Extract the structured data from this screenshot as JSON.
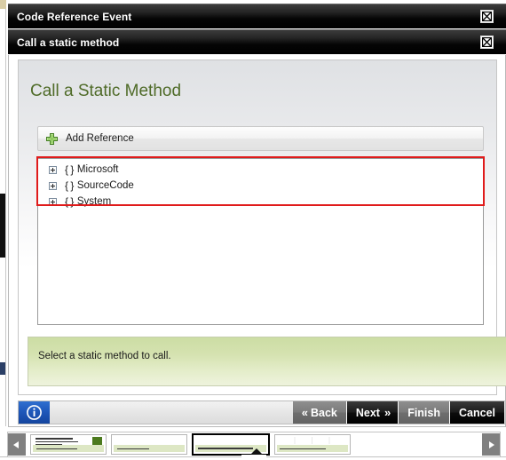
{
  "window": {
    "outer_title": "Code Reference Event",
    "inner_title": "Call a static method",
    "close_icon": "close-icon"
  },
  "page": {
    "heading": "Call a Static Method"
  },
  "toolbar": {
    "add_reference_label": "Add Reference",
    "add_icon": "plus-icon"
  },
  "tree": {
    "nodes": [
      {
        "expander": "expand-plus-icon",
        "icon": "{ }",
        "label": "Microsoft"
      },
      {
        "expander": "expand-plus-icon",
        "icon": "{ }",
        "label": "SourceCode"
      },
      {
        "expander": "expand-plus-icon",
        "icon": "{ }",
        "label": "System"
      }
    ]
  },
  "status": {
    "message": "Select a static method to call."
  },
  "buttons": {
    "info_icon": "info-icon",
    "back": {
      "label": "Back",
      "chevron": "«",
      "style": "gray"
    },
    "next": {
      "label": "Next",
      "chevron": "»",
      "style": "black"
    },
    "finish": {
      "label": "Finish",
      "style": "gray"
    },
    "cancel": {
      "label": "Cancel",
      "style": "black"
    }
  },
  "filmstrip": {
    "prev_icon": "arrow-left-icon",
    "next_icon": "arrow-right-icon",
    "selected_index": 2,
    "thumbnails": [
      {
        "name": "slide-thumbnail-1"
      },
      {
        "name": "slide-thumbnail-2"
      },
      {
        "name": "slide-thumbnail-3"
      },
      {
        "name": "slide-thumbnail-4"
      }
    ]
  },
  "colors": {
    "heading": "#4f6b28",
    "annotation": "#e01b1b",
    "status_bg": "#ccdda4",
    "info_blue": "#1e56b8",
    "plus_green": "#6fb03a"
  }
}
